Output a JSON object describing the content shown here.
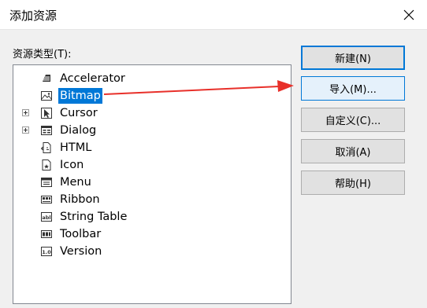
{
  "window": {
    "title": "添加资源",
    "close_icon": "close-icon"
  },
  "tree": {
    "label": "资源类型(T):",
    "items": [
      {
        "label": "Accelerator",
        "icon": "accelerator-icon",
        "expandable": false,
        "selected": false
      },
      {
        "label": "Bitmap",
        "icon": "bitmap-icon",
        "expandable": false,
        "selected": true
      },
      {
        "label": "Cursor",
        "icon": "cursor-icon",
        "expandable": true,
        "selected": false
      },
      {
        "label": "Dialog",
        "icon": "dialog-icon",
        "expandable": true,
        "selected": false
      },
      {
        "label": "HTML",
        "icon": "html-icon",
        "expandable": false,
        "selected": false
      },
      {
        "label": "Icon",
        "icon": "icon-resource-icon",
        "expandable": false,
        "selected": false
      },
      {
        "label": "Menu",
        "icon": "menu-icon",
        "expandable": false,
        "selected": false
      },
      {
        "label": "Ribbon",
        "icon": "ribbon-icon",
        "expandable": false,
        "selected": false
      },
      {
        "label": "String Table",
        "icon": "string-table-icon",
        "expandable": false,
        "selected": false
      },
      {
        "label": "Toolbar",
        "icon": "toolbar-icon",
        "expandable": false,
        "selected": false
      },
      {
        "label": "Version",
        "icon": "version-icon",
        "expandable": false,
        "selected": false
      }
    ]
  },
  "buttons": {
    "new": "新建(N)",
    "import": "导入(M)...",
    "custom": "自定义(C)...",
    "cancel": "取消(A)",
    "help": "帮助(H)"
  },
  "colors": {
    "selection": "#0078d7",
    "annotation_arrow": "#e8302a"
  }
}
